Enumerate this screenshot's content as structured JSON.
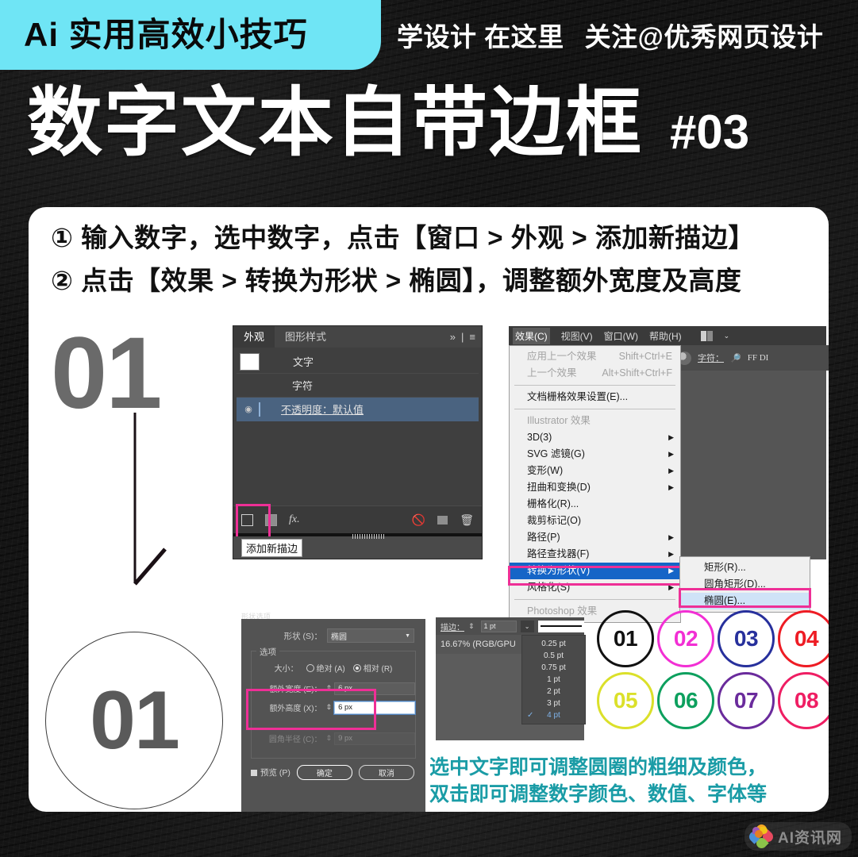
{
  "theme": {
    "cyan": "#6fe5f5",
    "magenta": "#ee2f96",
    "teal": "#1a9ca6"
  },
  "banner": {
    "tag": "Ai 实用高效小技巧",
    "right": [
      "学设计 在这里",
      "关注@优秀网页设计"
    ]
  },
  "headline": {
    "title": "数字文本自带边框",
    "number": "#03"
  },
  "steps": [
    "① 输入数字，选中数字，点击【窗口 > 外观 > 添加新描边】",
    "② 点击【效果 > 转换为形状 > 椭圆】，调整额外宽度及高度"
  ],
  "marker": {
    "big_number": "01",
    "circle_number": "01"
  },
  "appearance_panel": {
    "tabs": [
      {
        "label": "外观",
        "active": true
      },
      {
        "label": "图形样式",
        "active": false
      }
    ],
    "tab_icons": {
      "expand": "»",
      "menu": "≡"
    },
    "rows": [
      {
        "label": "文字",
        "swatch": true,
        "eye": false,
        "selected": false
      },
      {
        "label": "字符",
        "swatch": false,
        "eye": false,
        "selected": false
      },
      {
        "label": "不透明度：默认值",
        "swatch": false,
        "eye": true,
        "selected": true
      }
    ],
    "toolbar_icons": [
      "add-stroke",
      "add-fill",
      "fx",
      "clear",
      "duplicate",
      "delete"
    ],
    "fx_label": "fx.",
    "tooltip": "添加新描边"
  },
  "effects_menu": {
    "menubar": [
      "效果(C)",
      "视图(V)",
      "窗口(W)",
      "帮助(H)"
    ],
    "toolbar2": {
      "label": "字符：",
      "font": "FF DI"
    },
    "items": [
      {
        "label": "应用上一个效果",
        "shortcut": "Shift+Ctrl+E",
        "dim": true
      },
      {
        "label": "上一个效果",
        "shortcut": "Alt+Shift+Ctrl+F",
        "dim": true
      },
      {
        "sep": true
      },
      {
        "label": "文档栅格效果设置(E)...",
        "dim": false
      },
      {
        "sep": true
      },
      {
        "label": "Illustrator 效果",
        "dim": true
      },
      {
        "label": "3D(3)",
        "arrow": true
      },
      {
        "label": "SVG 滤镜(G)",
        "arrow": true
      },
      {
        "label": "变形(W)",
        "arrow": true
      },
      {
        "label": "扭曲和变换(D)",
        "arrow": true
      },
      {
        "label": "栅格化(R)..."
      },
      {
        "label": "裁剪标记(O)"
      },
      {
        "label": "路径(P)",
        "arrow": true
      },
      {
        "label": "路径查找器(F)",
        "arrow": true
      },
      {
        "label": "转换为形状(V)",
        "arrow": true,
        "selected": true
      },
      {
        "label": "风格化(S)",
        "arrow": true
      },
      {
        "sep": true
      },
      {
        "label": "Photoshop 效果",
        "dim": true
      }
    ],
    "submenu": [
      {
        "label": "矩形(R)..."
      },
      {
        "label": "圆角矩形(D)..."
      },
      {
        "label": "椭圆(E)...",
        "selected": true
      }
    ]
  },
  "shape_options": {
    "title": "形状选项",
    "shape_label": "形状 (S)：",
    "shape_value": "椭圆",
    "group_legend": "选项",
    "size_label": "大小：",
    "radio_absolute": "绝对 (A)",
    "radio_relative": "相对 (R)",
    "extra_width_label": "额外宽度 (E)：",
    "extra_width_value": "6 px",
    "extra_height_label": "额外高度 (X)：",
    "extra_height_value": "6 px",
    "corner_radius_label": "圆角半径 (C)：",
    "corner_radius_value": "9 px",
    "preview_label": "预览 (P)",
    "ok_label": "确定",
    "cancel_label": "取消"
  },
  "stroke_panel": {
    "label": "描边：",
    "value": "1 pt",
    "zoom": "16.67% (RGB/GPU",
    "options": [
      "0.25 pt",
      "0.5 pt",
      "0.75 pt",
      "1 pt",
      "2 pt",
      "3 pt",
      "4 pt"
    ],
    "selected_option": "4 pt"
  },
  "sample_circles": [
    {
      "num": "01",
      "color": "#111111"
    },
    {
      "num": "02",
      "color": "#f22fd4"
    },
    {
      "num": "03",
      "color": "#27309c"
    },
    {
      "num": "04",
      "color": "#ee1c24"
    },
    {
      "num": "05",
      "color": "#dbe02a"
    },
    {
      "num": "06",
      "color": "#0da05e"
    },
    {
      "num": "07",
      "color": "#6a2b9c"
    },
    {
      "num": "08",
      "color": "#ef1e63"
    }
  ],
  "caption": [
    "选中文字即可调整圆圈的粗细及颜色，",
    "双击即可调整数字颜色、数值、字体等"
  ],
  "watermark": {
    "text": "AI资讯网"
  }
}
